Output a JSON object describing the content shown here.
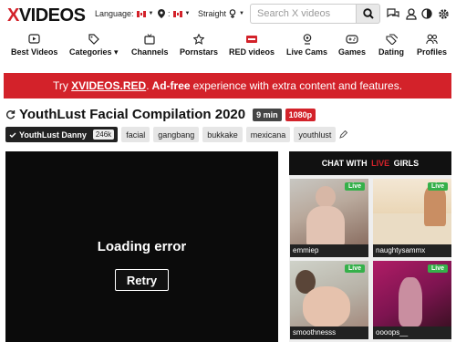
{
  "header": {
    "logo_x": "X",
    "logo_rest": "VIDEOS",
    "language_label": "Language:",
    "location_label": ":",
    "orientation_label": "Straight",
    "search_placeholder": "Search X videos"
  },
  "nav": {
    "items": [
      {
        "label": "Best Videos",
        "icon": "play-box-icon"
      },
      {
        "label": "Categories ▾",
        "icon": "tag-icon"
      },
      {
        "label": "Channels",
        "icon": "tv-icon"
      },
      {
        "label": "Pornstars",
        "icon": "star-icon"
      },
      {
        "label": "RED videos",
        "icon": "red-logo-icon"
      },
      {
        "label": "Live Cams",
        "icon": "webcam-icon"
      },
      {
        "label": "Games",
        "icon": "gamepad-icon"
      },
      {
        "label": "Dating",
        "icon": "tags-icon"
      },
      {
        "label": "Profiles",
        "icon": "users-icon"
      }
    ]
  },
  "banner": {
    "prefix": "Try",
    "brand": "XVIDEOS.RED",
    "mid": ".",
    "adfree": "Ad-free",
    "suffix": "experience with extra content and features."
  },
  "video": {
    "title": "YouthLust Facial Compilation 2020",
    "duration": "9 min",
    "quality": "1080p",
    "uploader": "YouthLust Danny",
    "uploader_count": "246k",
    "tags": [
      "facial",
      "gangbang",
      "bukkake",
      "mexicana",
      "youthlust"
    ],
    "error_text": "Loading error",
    "retry_label": "Retry"
  },
  "chat": {
    "head_prefix": "CHAT WITH",
    "head_live": "LIVE",
    "head_suffix": "GIRLS",
    "live_label": "Live",
    "cams": [
      {
        "name": "emmiep"
      },
      {
        "name": "naughtysammx"
      },
      {
        "name": "smoothnesss"
      },
      {
        "name": "oooops__"
      }
    ]
  },
  "colors": {
    "brand_red": "#d3222a",
    "live_green": "#35b04a"
  }
}
